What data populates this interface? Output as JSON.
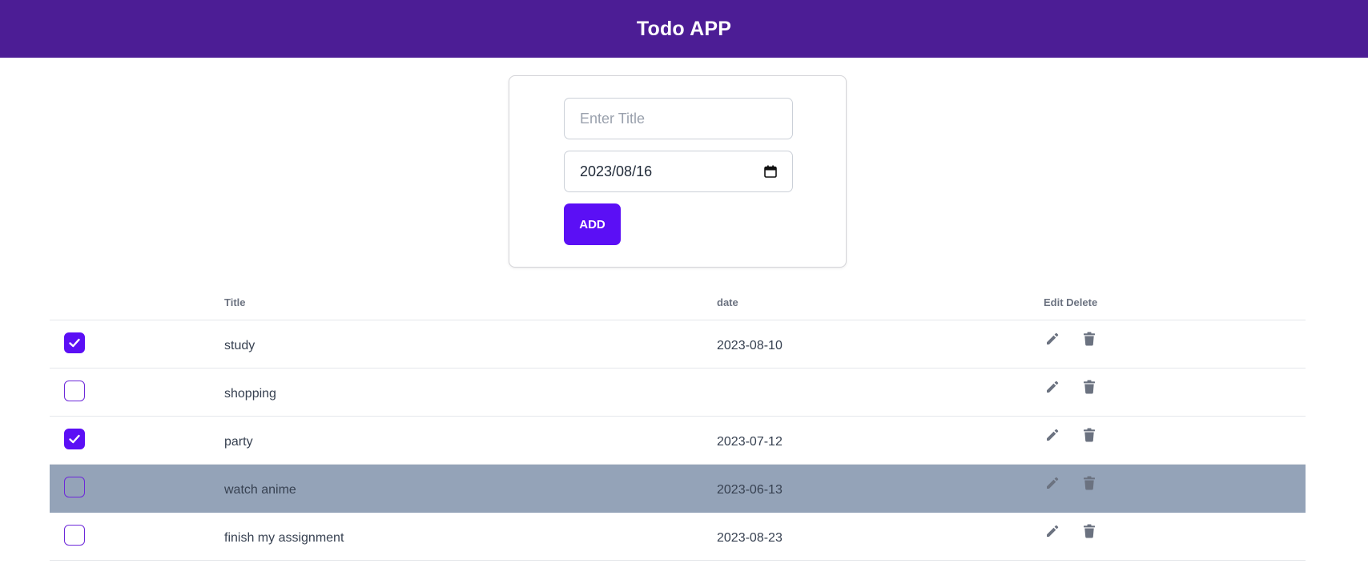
{
  "app": {
    "title": "Todo APP"
  },
  "form": {
    "title_placeholder": "Enter Title",
    "title_value": "",
    "date_value": "2023/08/16",
    "add_label": "ADD"
  },
  "table": {
    "headers": {
      "check": "",
      "title": "Title",
      "date": "date",
      "actions": "Edit Delete"
    },
    "rows": [
      {
        "checked": true,
        "title": "study",
        "date": "2023-08-10",
        "highlighted": false
      },
      {
        "checked": false,
        "title": "shopping",
        "date": "",
        "highlighted": false
      },
      {
        "checked": true,
        "title": "party",
        "date": "2023-07-12",
        "highlighted": false
      },
      {
        "checked": false,
        "title": "watch anime",
        "date": "2023-06-13",
        "highlighted": true
      },
      {
        "checked": false,
        "title": "finish my assignment",
        "date": "2023-08-23",
        "highlighted": false
      }
    ]
  },
  "colors": {
    "header_bg": "#4c1d95",
    "accent": "#5b0ff5",
    "highlight_row": "#94a3b8",
    "icon": "#6b7280"
  },
  "icons": {
    "calendar": "calendar-icon",
    "edit": "pencil-icon",
    "delete": "trash-icon",
    "check": "check-icon"
  }
}
